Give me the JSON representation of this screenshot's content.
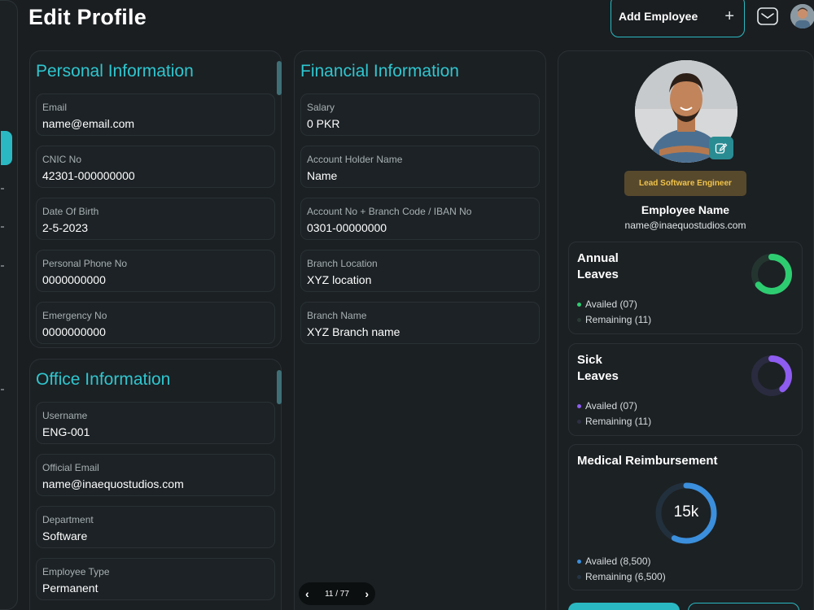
{
  "page": {
    "title": "Edit Profile"
  },
  "header": {
    "add_employee_label": "Add Employee",
    "add_icon": "plus-icon",
    "mail_icon": "mail-icon"
  },
  "personal": {
    "title": "Personal Information",
    "fields": [
      {
        "label": "Email",
        "value": "name@email.com"
      },
      {
        "label": "CNIC No",
        "value": "42301-000000000"
      },
      {
        "label": "Date Of Birth",
        "value": "2-5-2023"
      },
      {
        "label": "Personal Phone No",
        "value": "0000000000"
      },
      {
        "label": "Emergency No",
        "value": "0000000000"
      }
    ]
  },
  "office": {
    "title": "Office Information",
    "fields": [
      {
        "label": "Username",
        "value": "ENG-001"
      },
      {
        "label": "Official Email",
        "value": "name@inaequostudios.com"
      },
      {
        "label": "Department",
        "value": "Software"
      },
      {
        "label": "Employee Type",
        "value": "Permanent"
      }
    ]
  },
  "financial": {
    "title": "Financial Information",
    "fields": [
      {
        "label": "Salary",
        "value": "0 PKR"
      },
      {
        "label": "Account Holder Name",
        "value": "Name"
      },
      {
        "label": "Account No + Branch Code / IBAN No",
        "value": "0301-00000000"
      },
      {
        "label": "Branch Location",
        "value": "XYZ location"
      },
      {
        "label": "Branch Name",
        "value": "XYZ Branch name"
      }
    ]
  },
  "pager": {
    "text": "11 / 77",
    "prev_icon": "chevron-left-icon",
    "next_icon": "chevron-right-icon"
  },
  "profile": {
    "role": "Lead Software Engineer",
    "name": "Employee Name",
    "email": "name@inaequostudios.com",
    "edit_icon": "edit-icon"
  },
  "annual": {
    "title_line1": "Annual",
    "title_line2": "Leaves",
    "availed": "Availed (07)",
    "remaining": "Remaining (11)",
    "fraction": 0.64,
    "color": "#2ecc71"
  },
  "sick": {
    "title_line1": "Sick",
    "title_line2": "Leaves",
    "availed": "Availed (07)",
    "remaining": "Remaining (11)",
    "fraction": 0.39,
    "color": "#8e5cf0"
  },
  "medical": {
    "title": "Medical Reimbursement",
    "center": "15k",
    "availed": "Availed (8,500)",
    "remaining": "Remaining (6,500)",
    "fraction": 0.57,
    "color": "#3b8fdc"
  },
  "colors": {
    "accent": "#2ab9c2",
    "background": "#1a1e21",
    "badge": "#57492c",
    "badge_text": "#f0c34a"
  }
}
